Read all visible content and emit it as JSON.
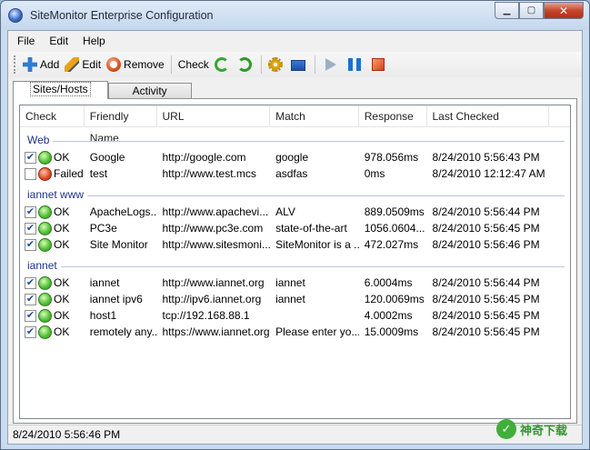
{
  "window": {
    "title": "SiteMonitor Enterprise Configuration"
  },
  "menu": {
    "file": "File",
    "edit": "Edit",
    "help": "Help"
  },
  "toolbar": {
    "add": "Add",
    "edit": "Edit",
    "remove": "Remove",
    "check": "Check"
  },
  "tabs": [
    {
      "label": "Sites/Hosts"
    },
    {
      "label": "Activity"
    }
  ],
  "columns": {
    "check": "Check",
    "name": "Friendly Name",
    "url": "URL",
    "match": "Match",
    "response": "Response",
    "last": "Last Checked"
  },
  "groups": [
    {
      "title": "Web",
      "rows": [
        {
          "status": "OK",
          "ok": true,
          "name": "Google",
          "url": "http://google.com",
          "match": "google",
          "response": "978.056ms",
          "last": "8/24/2010 5:56:43 PM"
        },
        {
          "status": "Failed",
          "ok": false,
          "name": "test",
          "url": "http://www.test.mcs",
          "match": "asdfas",
          "response": "0ms",
          "last": "8/24/2010 12:12:47 AM"
        }
      ]
    },
    {
      "title": "iannet www",
      "rows": [
        {
          "status": "OK",
          "ok": true,
          "name": "ApacheLogs...",
          "url": "http://www.apachevi...",
          "match": "ALV",
          "response": "889.0509ms",
          "last": "8/24/2010 5:56:44 PM"
        },
        {
          "status": "OK",
          "ok": true,
          "name": "PC3e",
          "url": "http://www.pc3e.com",
          "match": "state-of-the-art",
          "response": "1056.0604...",
          "last": "8/24/2010 5:56:45 PM"
        },
        {
          "status": "OK",
          "ok": true,
          "name": "Site Monitor",
          "url": "http://www.sitesmoni...",
          "match": "SiteMonitor is a ...",
          "response": "472.027ms",
          "last": "8/24/2010 5:56:46 PM"
        }
      ]
    },
    {
      "title": "iannet",
      "rows": [
        {
          "status": "OK",
          "ok": true,
          "name": "iannet",
          "url": "http://www.iannet.org",
          "match": "iannet",
          "response": "6.0004ms",
          "last": "8/24/2010 5:56:44 PM"
        },
        {
          "status": "OK",
          "ok": true,
          "name": "iannet ipv6",
          "url": "http://ipv6.iannet.org",
          "match": "iannet",
          "response": "120.0069ms",
          "last": "8/24/2010 5:56:45 PM"
        },
        {
          "status": "OK",
          "ok": true,
          "name": "host1",
          "url": "tcp://192.168.88.1",
          "match": "",
          "response": "4.0002ms",
          "last": "8/24/2010 5:56:45 PM"
        },
        {
          "status": "OK",
          "ok": true,
          "name": "remotely any...",
          "url": "https://www.iannet.org",
          "match": "Please enter yo...",
          "response": "15.0009ms",
          "last": "8/24/2010 5:56:45 PM"
        }
      ]
    }
  ],
  "status": {
    "text": "8/24/2010 5:56:46 PM"
  },
  "watermark": {
    "text": "神奇下载"
  },
  "colors": {
    "ok": "#55c23a",
    "fail": "#e24f2d",
    "group": "#1e3287"
  }
}
